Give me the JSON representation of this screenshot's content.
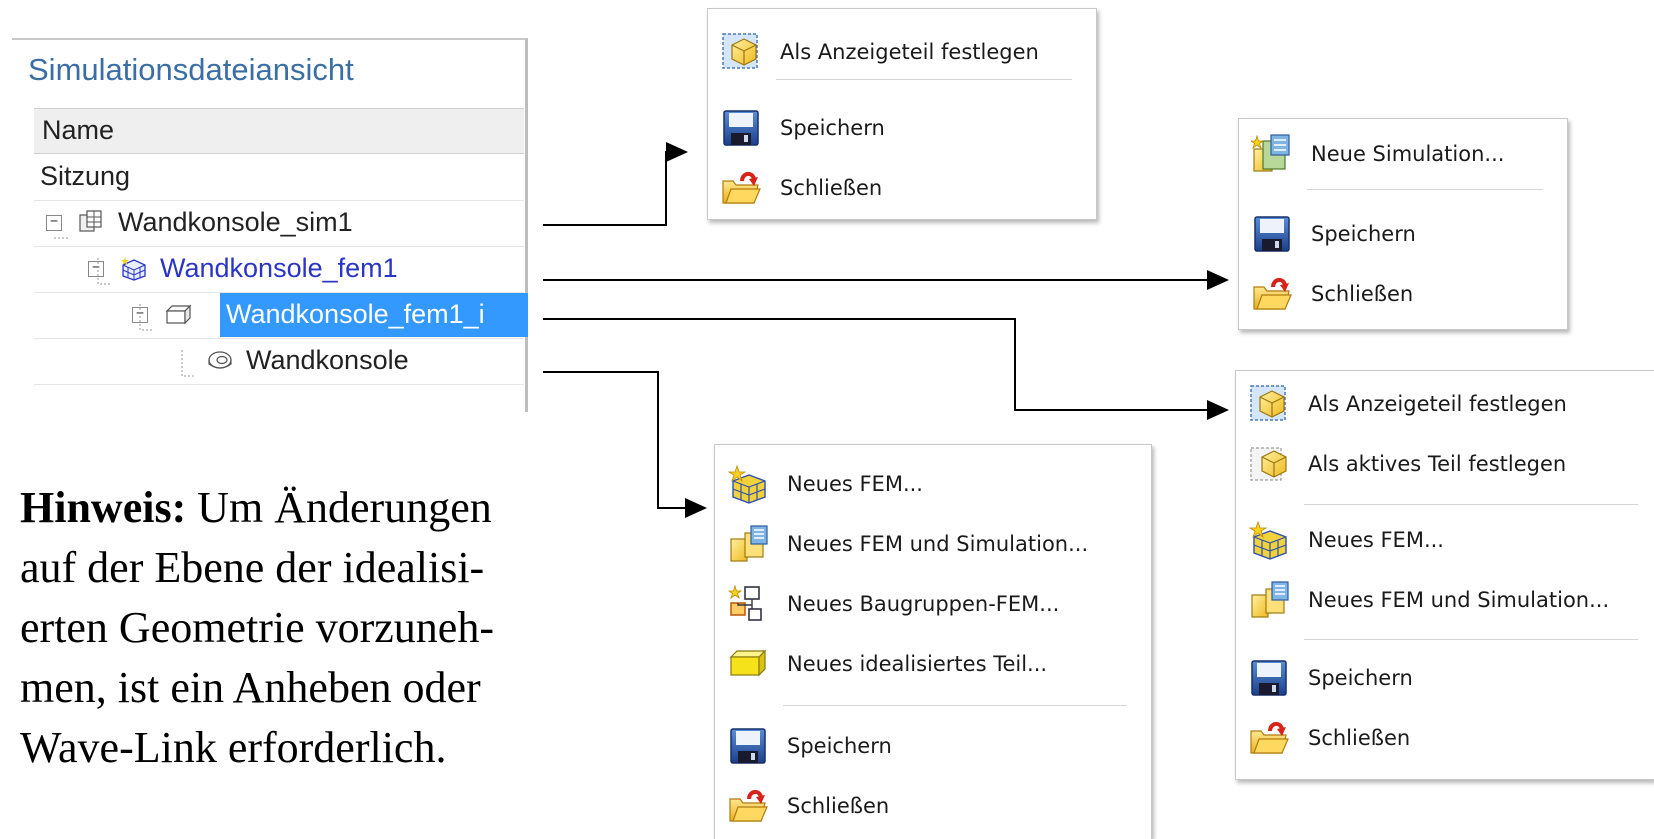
{
  "navigator": {
    "title": "Simulationsdateiansicht",
    "column_header": "Name",
    "session_label": "Sitzung",
    "tree": [
      {
        "label": "Wandkonsole_sim1",
        "toggle": "−",
        "icon": "simulation-icon"
      },
      {
        "label": "Wandkonsole_fem1",
        "toggle": "−",
        "icon": "fem-mesh-icon"
      },
      {
        "label": "Wandkonsole_fem1_i",
        "toggle": "−",
        "icon": "idealized-part-icon",
        "selected": true
      },
      {
        "label": "Wandkonsole",
        "icon": "part-icon"
      }
    ]
  },
  "menus": {
    "sim_menu": {
      "items": [
        {
          "label": "Als Anzeigeteil festlegen",
          "icon": "display-part-icon"
        },
        {
          "label": "Speichern",
          "icon": "save-icon"
        },
        {
          "label": "Schließen",
          "icon": "close-folder-icon"
        }
      ]
    },
    "fem_menu": {
      "items": [
        {
          "label": "Neue Simulation...",
          "icon": "new-simulation-icon"
        },
        {
          "label": "Speichern",
          "icon": "save-icon"
        },
        {
          "label": "Schließen",
          "icon": "close-folder-icon"
        }
      ]
    },
    "idealized_menu": {
      "items": [
        {
          "label": "Als Anzeigeteil festlegen",
          "icon": "display-part-icon"
        },
        {
          "label": "Als aktives Teil festlegen",
          "icon": "active-part-icon"
        },
        {
          "label": "Neues FEM...",
          "icon": "new-fem-icon"
        },
        {
          "label": "Neues FEM und Simulation...",
          "icon": "new-fem-simulation-icon"
        },
        {
          "label": "Speichern",
          "icon": "save-icon"
        },
        {
          "label": "Schließen",
          "icon": "close-folder-icon"
        }
      ]
    },
    "part_menu": {
      "items": [
        {
          "label": "Neues FEM...",
          "icon": "new-fem-icon"
        },
        {
          "label": "Neues FEM und Simulation...",
          "icon": "new-fem-simulation-icon"
        },
        {
          "label": "Neues Baugruppen-FEM...",
          "icon": "new-assembly-fem-icon"
        },
        {
          "label": "Neues idealisiertes Teil...",
          "icon": "new-idealized-part-icon"
        },
        {
          "label": "Speichern",
          "icon": "save-icon"
        },
        {
          "label": "Schließen",
          "icon": "close-folder-icon"
        }
      ]
    }
  },
  "hint": {
    "label": "Hinweis:",
    "line1": " Um Änderungen",
    "line2": "auf der Ebene der idealisi-",
    "line3": "erten Geometrie vorzuneh-",
    "line4": "men, ist ein Anheben oder",
    "line5": "Wave-Link erforderlich."
  },
  "colors": {
    "selection": "#3399ff",
    "title_blue": "#3a6ea5",
    "fem_link_blue": "#2a35c8"
  }
}
